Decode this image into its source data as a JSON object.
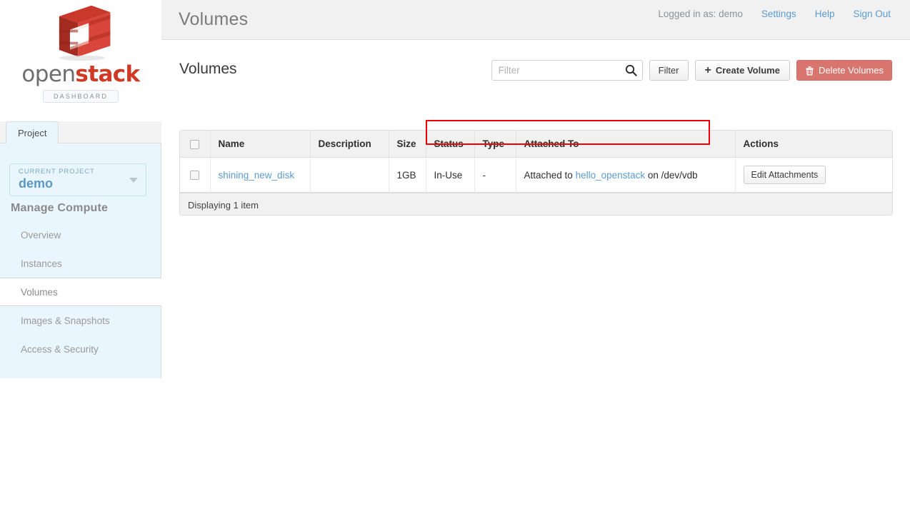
{
  "brand": {
    "logo_icon": "openstack-cube-logo",
    "word_open": "open",
    "word_stack": "stack",
    "dashboard_pill": "DASHBOARD",
    "accent_red": "#cf3a25",
    "accent_blue": "#5c9cd0"
  },
  "sidebar": {
    "tab": "Project",
    "project_selector": {
      "label": "CURRENT PROJECT",
      "value": "demo",
      "caret_icon": "chevron-down-icon"
    },
    "section_heading": "Manage Compute",
    "items": [
      {
        "label": "Overview",
        "active": false
      },
      {
        "label": "Instances",
        "active": false
      },
      {
        "label": "Volumes",
        "active": true
      },
      {
        "label": "Images & Snapshots",
        "active": false
      },
      {
        "label": "Access & Security",
        "active": false
      }
    ]
  },
  "header": {
    "page_title": "Volumes",
    "logged_in_as": "Logged in as: demo",
    "links": [
      {
        "label": "Settings"
      },
      {
        "label": "Help"
      },
      {
        "label": "Sign Out"
      }
    ]
  },
  "main": {
    "title": "Volumes",
    "toolbar": {
      "search_placeholder": "Filter",
      "search_value": "",
      "search_icon": "search-icon",
      "filter_button": "Filter",
      "create_button": "Create Volume",
      "create_icon": "plus-icon",
      "delete_button": "Delete Volumes",
      "delete_icon": "trash-icon",
      "delete_color": "#d9756f"
    },
    "table": {
      "columns": [
        "",
        "Name",
        "Description",
        "Size",
        "Status",
        "Type",
        "Attached To",
        "Actions"
      ],
      "rows": [
        {
          "name": "shining_new_disk",
          "description": "",
          "size": "1GB",
          "status": "In-Use",
          "type": "-",
          "attached_prefix": "Attached to ",
          "attached_instance": "hello_openstack",
          "attached_suffix": " on /dev/vdb",
          "action": "Edit Attachments"
        }
      ],
      "footer": "Displaying 1 item"
    },
    "annotation": {
      "highlight_color": "#f00000",
      "highlight_target": "status-type-attached-cells"
    }
  }
}
